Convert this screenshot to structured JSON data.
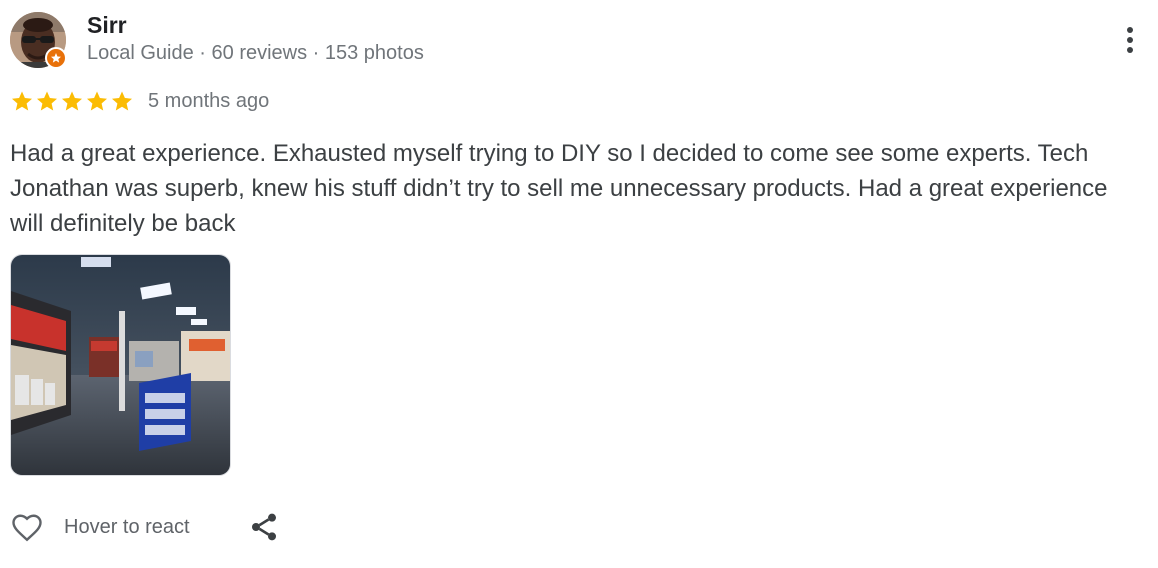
{
  "reviewer": {
    "name": "Sirr",
    "meta": "Local Guide · 60 reviews · 153 photos"
  },
  "rating": {
    "stars": 5,
    "max": 5,
    "time": "5 months ago",
    "star_color": "#fbbc04"
  },
  "review": {
    "text": "Had a great experience. Exhausted myself trying to DIY so I decided to come see some experts. Tech Jonathan was superb, knew his stuff didn’t try to sell me unnecessary products. Had a great experience will definitely be back"
  },
  "actions": {
    "react_label": "Hover to react"
  },
  "icons": {
    "menu": "more-vert-icon",
    "react": "heart-outline-icon",
    "share": "share-icon",
    "badge": "local-guide-star-icon"
  },
  "colors": {
    "badge": "#e8710a",
    "name": "#202124",
    "secondary": "#70757a"
  }
}
